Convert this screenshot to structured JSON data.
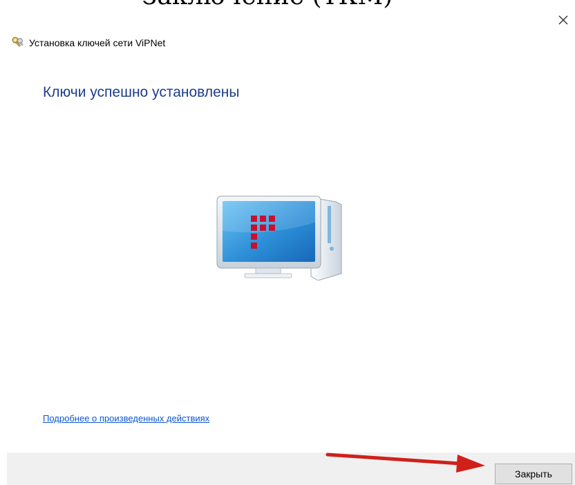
{
  "top_text": "Заключение (ТКМ)",
  "window": {
    "title": "Установка ключей сети ViPNet"
  },
  "main": {
    "heading": "Ключи успешно установлены",
    "details_link": "Подробнее о произведенных действиях"
  },
  "footer": {
    "close_label": "Закрыть"
  },
  "colors": {
    "heading": "#1b3d8f",
    "link": "#0b57d0",
    "footer_bg": "#f0f0f0",
    "button_bg": "#e1e1e1",
    "arrow": "#d0201a",
    "logo_red": "#c8102e"
  },
  "icons": {
    "window": "vipnet-keys-icon",
    "illustration": "computer-icon",
    "close": "close-icon",
    "annotation": "red-arrow"
  }
}
